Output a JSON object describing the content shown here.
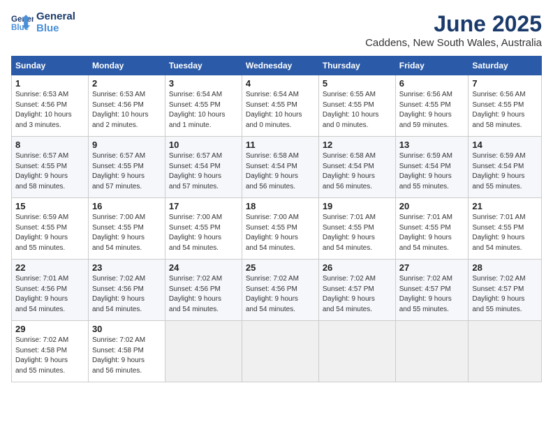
{
  "logo": {
    "line1": "General",
    "line2": "Blue"
  },
  "title": "June 2025",
  "subtitle": "Caddens, New South Wales, Australia",
  "weekdays": [
    "Sunday",
    "Monday",
    "Tuesday",
    "Wednesday",
    "Thursday",
    "Friday",
    "Saturday"
  ],
  "weeks": [
    [
      {
        "day": 1,
        "detail": "Sunrise: 6:53 AM\nSunset: 4:56 PM\nDaylight: 10 hours\nand 3 minutes."
      },
      {
        "day": 2,
        "detail": "Sunrise: 6:53 AM\nSunset: 4:56 PM\nDaylight: 10 hours\nand 2 minutes."
      },
      {
        "day": 3,
        "detail": "Sunrise: 6:54 AM\nSunset: 4:55 PM\nDaylight: 10 hours\nand 1 minute."
      },
      {
        "day": 4,
        "detail": "Sunrise: 6:54 AM\nSunset: 4:55 PM\nDaylight: 10 hours\nand 0 minutes."
      },
      {
        "day": 5,
        "detail": "Sunrise: 6:55 AM\nSunset: 4:55 PM\nDaylight: 10 hours\nand 0 minutes."
      },
      {
        "day": 6,
        "detail": "Sunrise: 6:56 AM\nSunset: 4:55 PM\nDaylight: 9 hours\nand 59 minutes."
      },
      {
        "day": 7,
        "detail": "Sunrise: 6:56 AM\nSunset: 4:55 PM\nDaylight: 9 hours\nand 58 minutes."
      }
    ],
    [
      {
        "day": 8,
        "detail": "Sunrise: 6:57 AM\nSunset: 4:55 PM\nDaylight: 9 hours\nand 58 minutes."
      },
      {
        "day": 9,
        "detail": "Sunrise: 6:57 AM\nSunset: 4:55 PM\nDaylight: 9 hours\nand 57 minutes."
      },
      {
        "day": 10,
        "detail": "Sunrise: 6:57 AM\nSunset: 4:54 PM\nDaylight: 9 hours\nand 57 minutes."
      },
      {
        "day": 11,
        "detail": "Sunrise: 6:58 AM\nSunset: 4:54 PM\nDaylight: 9 hours\nand 56 minutes."
      },
      {
        "day": 12,
        "detail": "Sunrise: 6:58 AM\nSunset: 4:54 PM\nDaylight: 9 hours\nand 56 minutes."
      },
      {
        "day": 13,
        "detail": "Sunrise: 6:59 AM\nSunset: 4:54 PM\nDaylight: 9 hours\nand 55 minutes."
      },
      {
        "day": 14,
        "detail": "Sunrise: 6:59 AM\nSunset: 4:54 PM\nDaylight: 9 hours\nand 55 minutes."
      }
    ],
    [
      {
        "day": 15,
        "detail": "Sunrise: 6:59 AM\nSunset: 4:55 PM\nDaylight: 9 hours\nand 55 minutes."
      },
      {
        "day": 16,
        "detail": "Sunrise: 7:00 AM\nSunset: 4:55 PM\nDaylight: 9 hours\nand 54 minutes."
      },
      {
        "day": 17,
        "detail": "Sunrise: 7:00 AM\nSunset: 4:55 PM\nDaylight: 9 hours\nand 54 minutes."
      },
      {
        "day": 18,
        "detail": "Sunrise: 7:00 AM\nSunset: 4:55 PM\nDaylight: 9 hours\nand 54 minutes."
      },
      {
        "day": 19,
        "detail": "Sunrise: 7:01 AM\nSunset: 4:55 PM\nDaylight: 9 hours\nand 54 minutes."
      },
      {
        "day": 20,
        "detail": "Sunrise: 7:01 AM\nSunset: 4:55 PM\nDaylight: 9 hours\nand 54 minutes."
      },
      {
        "day": 21,
        "detail": "Sunrise: 7:01 AM\nSunset: 4:55 PM\nDaylight: 9 hours\nand 54 minutes."
      }
    ],
    [
      {
        "day": 22,
        "detail": "Sunrise: 7:01 AM\nSunset: 4:56 PM\nDaylight: 9 hours\nand 54 minutes."
      },
      {
        "day": 23,
        "detail": "Sunrise: 7:02 AM\nSunset: 4:56 PM\nDaylight: 9 hours\nand 54 minutes."
      },
      {
        "day": 24,
        "detail": "Sunrise: 7:02 AM\nSunset: 4:56 PM\nDaylight: 9 hours\nand 54 minutes."
      },
      {
        "day": 25,
        "detail": "Sunrise: 7:02 AM\nSunset: 4:56 PM\nDaylight: 9 hours\nand 54 minutes."
      },
      {
        "day": 26,
        "detail": "Sunrise: 7:02 AM\nSunset: 4:57 PM\nDaylight: 9 hours\nand 54 minutes."
      },
      {
        "day": 27,
        "detail": "Sunrise: 7:02 AM\nSunset: 4:57 PM\nDaylight: 9 hours\nand 55 minutes."
      },
      {
        "day": 28,
        "detail": "Sunrise: 7:02 AM\nSunset: 4:57 PM\nDaylight: 9 hours\nand 55 minutes."
      }
    ],
    [
      {
        "day": 29,
        "detail": "Sunrise: 7:02 AM\nSunset: 4:58 PM\nDaylight: 9 hours\nand 55 minutes."
      },
      {
        "day": 30,
        "detail": "Sunrise: 7:02 AM\nSunset: 4:58 PM\nDaylight: 9 hours\nand 56 minutes."
      },
      null,
      null,
      null,
      null,
      null
    ]
  ]
}
